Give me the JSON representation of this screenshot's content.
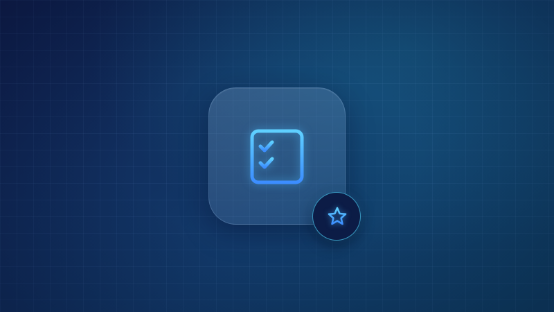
{
  "colors": {
    "background_dark": "#0f1f4e",
    "background_teal": "#0f4468",
    "icon_accent": "#4fc3ff",
    "badge_fill": "#0c1c46",
    "badge_border": "#46bee6"
  },
  "app_tile": {
    "icon": "checklist-icon"
  },
  "badge": {
    "icon": "star-icon"
  }
}
